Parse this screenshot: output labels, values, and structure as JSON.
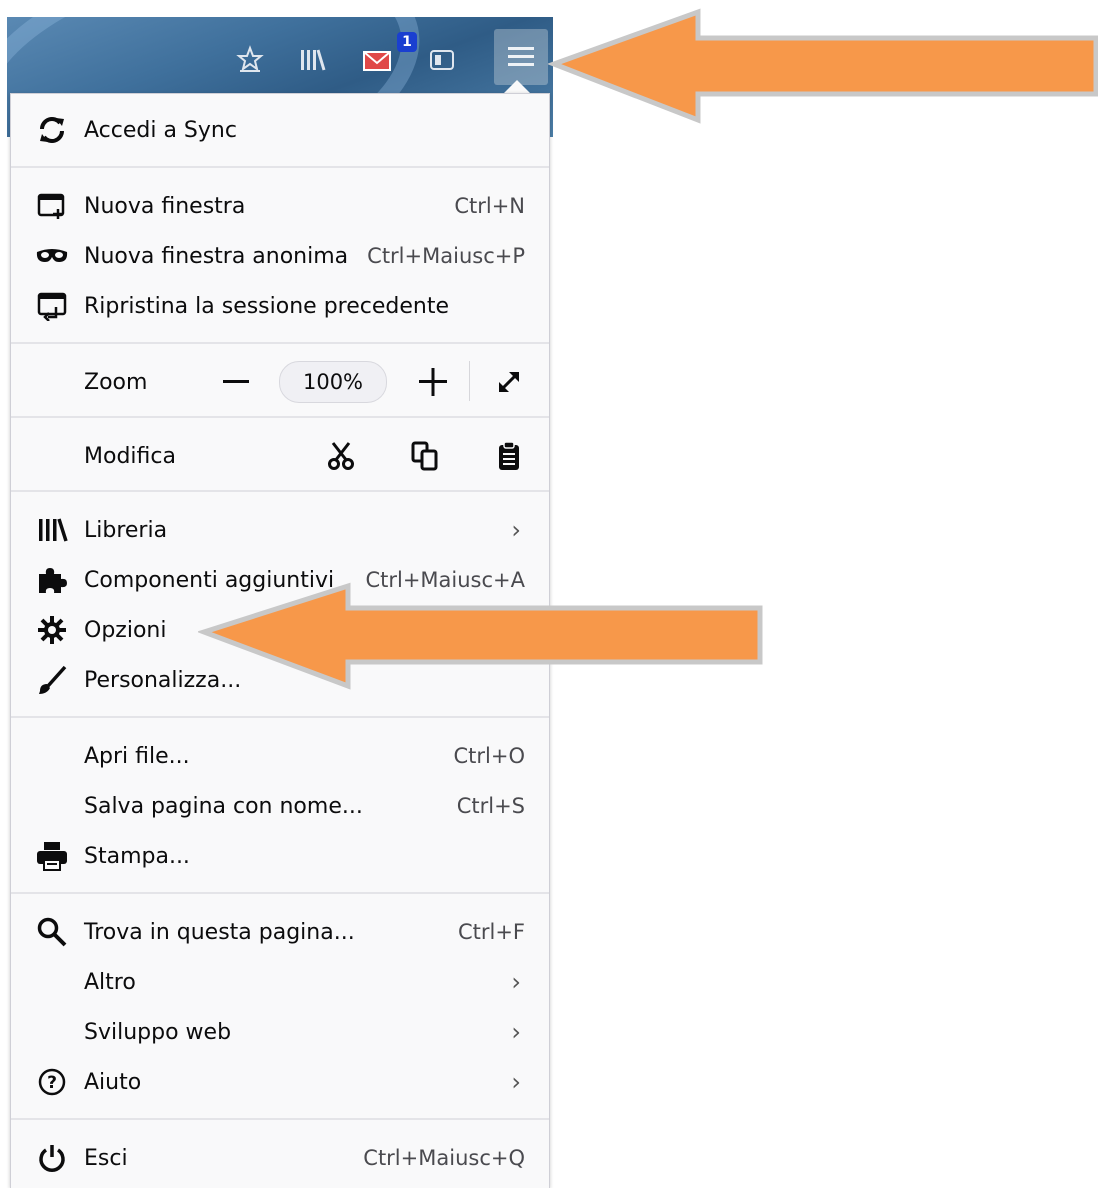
{
  "toolbar": {
    "notification_count": "1"
  },
  "menu": {
    "sync": {
      "label": "Accedi a Sync"
    },
    "new_window": {
      "label": "Nuova finestra",
      "shortcut": "Ctrl+N"
    },
    "private_window": {
      "label": "Nuova finestra anonima",
      "shortcut": "Ctrl+Maiusc+P"
    },
    "restore_session": {
      "label": "Ripristina la sessione precedente"
    },
    "zoom": {
      "label": "Zoom",
      "value": "100%"
    },
    "edit": {
      "label": "Modifica"
    },
    "library": {
      "label": "Libreria"
    },
    "addons": {
      "label": "Componenti aggiuntivi",
      "shortcut": "Ctrl+Maiusc+A"
    },
    "options": {
      "label": "Opzioni"
    },
    "customize": {
      "label": "Personalizza..."
    },
    "open_file": {
      "label": "Apri file...",
      "shortcut": "Ctrl+O"
    },
    "save_page": {
      "label": "Salva pagina con nome...",
      "shortcut": "Ctrl+S"
    },
    "print": {
      "label": "Stampa..."
    },
    "find": {
      "label": "Trova in questa pagina...",
      "shortcut": "Ctrl+F"
    },
    "more": {
      "label": "Altro"
    },
    "web_dev": {
      "label": "Sviluppo web"
    },
    "help": {
      "label": "Aiuto"
    },
    "quit": {
      "label": "Esci",
      "shortcut": "Ctrl+Maiusc+Q"
    }
  },
  "colors": {
    "arrow_fill": "#f7984a",
    "arrow_outline": "#c8c8c8",
    "menu_bg": "#f9f9fa"
  }
}
